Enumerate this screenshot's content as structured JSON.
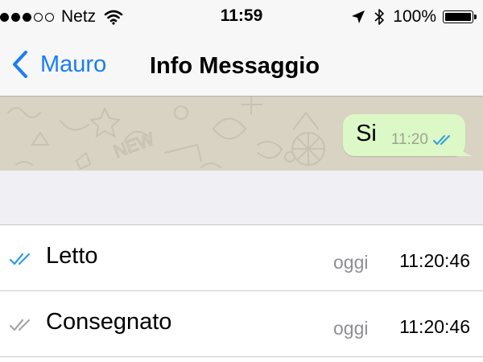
{
  "status_bar": {
    "signal_dots_full": 3,
    "signal_dots_empty": 2,
    "carrier": "Netz",
    "time": "11:59",
    "battery": "100%",
    "icons": [
      "wifi-icon",
      "location-arrow-icon",
      "bluetooth-icon",
      "battery-icon"
    ]
  },
  "nav": {
    "back_label": "Mauro",
    "title": "Info Messaggio"
  },
  "message": {
    "text": "Si",
    "time": "11:20",
    "status_icon": "double-check-icon",
    "status_color": "#2f9ce0"
  },
  "receipts": [
    {
      "label": "Letto",
      "day": "oggi",
      "time": "11:20:46",
      "icon": "double-check-icon",
      "color": "#2f9ce0"
    },
    {
      "label": "Consegnato",
      "day": "oggi",
      "time": "11:20:46",
      "icon": "double-check-icon",
      "color": "#a4a4a8"
    }
  ],
  "colors": {
    "accent": "#1a7df5",
    "bubble": "#dcf8c6",
    "chat_background": "#d9d3c4",
    "group_background": "#efeff4"
  }
}
